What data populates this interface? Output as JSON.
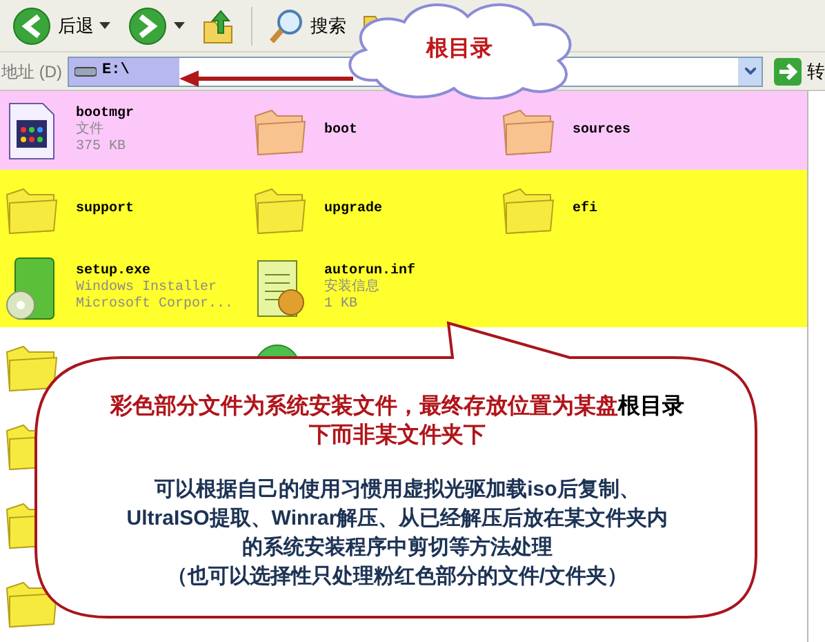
{
  "toolbar": {
    "buttons": [
      {
        "kind": "back",
        "label": "后退",
        "dropdown": true
      },
      {
        "kind": "forward",
        "dropdown": true
      },
      {
        "kind": "up"
      },
      {
        "kind": "search",
        "label": "搜索"
      },
      {
        "kind": "folders"
      }
    ]
  },
  "address_bar": {
    "label": "地址 (D)",
    "value": "E:\\",
    "go_label": "转"
  },
  "rows": [
    {
      "color": "#fcc8fa",
      "items": [
        {
          "kind": "exe",
          "name": "bootmgr",
          "details": [
            "文件",
            "375 KB"
          ]
        },
        {
          "kind": "folder",
          "name": "boot"
        },
        {
          "kind": "folder",
          "name": "sources"
        }
      ]
    },
    {
      "color": "#ffff2e",
      "items": [
        {
          "kind": "folder",
          "name": "support"
        },
        {
          "kind": "folder",
          "name": "upgrade"
        },
        {
          "kind": "folder",
          "name": "efi"
        }
      ]
    },
    {
      "color": "#ffff2e",
      "items": [
        {
          "kind": "installer",
          "name": "setup.exe",
          "details": [
            "Windows Installer",
            "Microsoft Corpor..."
          ]
        },
        {
          "kind": "inf",
          "name": "autorun.inf",
          "details": [
            "安装信息",
            "1 KB"
          ]
        }
      ]
    },
    {
      "color": "#ffffff",
      "items": [
        {
          "kind": "folder"
        },
        {
          "kind": "disc"
        }
      ]
    },
    {
      "color": "#ffffff",
      "items": [
        {
          "kind": "folder"
        }
      ]
    },
    {
      "color": "#ffffff",
      "items": [
        {
          "kind": "folder"
        }
      ]
    },
    {
      "color": "#ffffff",
      "items": [
        {
          "kind": "folder"
        }
      ]
    }
  ],
  "cloud_note": {
    "text": "根目录"
  },
  "callout": {
    "paragraphs": [
      {
        "lines": [
          [
            {
              "kind": "red",
              "text": "彩色部分文件为系统安装文件，最终存放位置为某盘"
            },
            {
              "kind": "black",
              "text": "根目录"
            }
          ],
          [
            {
              "kind": "red",
              "text": "下而非某文件夹下"
            }
          ]
        ]
      },
      {
        "lines": [
          [
            {
              "kind": "navy",
              "text": "可以根据自己的使用习惯用虚拟光驱加载iso后复制、"
            }
          ],
          [
            {
              "kind": "navy",
              "text": "UltraISO提取、Winrar解压、从已经解压后放在某文件夹内"
            }
          ],
          [
            {
              "kind": "navy",
              "text": "的系统安装程序中剪切等方法处理"
            }
          ],
          [
            {
              "kind": "navy",
              "text": "（也可以选择性只处理粉红色部分的文件/文件夹）"
            }
          ]
        ]
      }
    ]
  }
}
